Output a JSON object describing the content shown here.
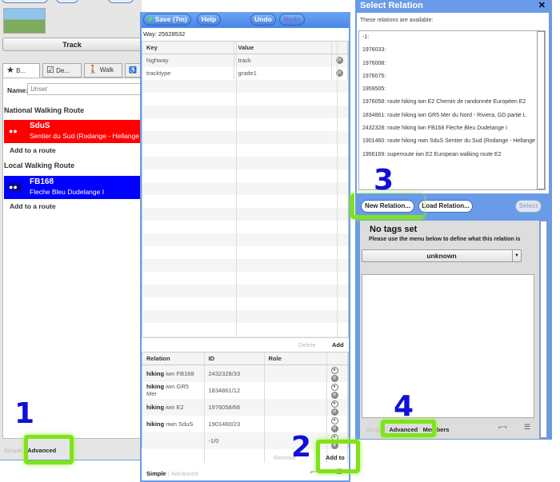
{
  "left_panel": {
    "preset": "Track",
    "tabs": [
      "B...",
      "De...",
      "Walk"
    ],
    "name_label": "Name:",
    "name_placeholder": "Unset",
    "sections": [
      {
        "heading": "National Walking Route",
        "ref": "SduS",
        "name": "Sentier du Sud (Rodange - Hellange",
        "color": "#ff0000",
        "action": "Add to a route"
      },
      {
        "heading": "Local Walking Route",
        "ref": "FB168",
        "name": "Fleche Bleu Dudelange I",
        "color": "#0000ff",
        "action": "Add to a route"
      }
    ],
    "footer": {
      "simple": "Simple",
      "advanced": "Advanced"
    }
  },
  "editor": {
    "toolbar": {
      "save": "Save (7m)",
      "help": "Help",
      "undo": "Undo",
      "redo": "Redo"
    },
    "way": "Way: 25628532",
    "tag_headers": [
      "Key",
      "Value"
    ],
    "tags": [
      [
        "highway",
        "track"
      ],
      [
        "tracktype",
        "grade1"
      ]
    ],
    "delete": "Delete",
    "add": "Add",
    "rel_headers": [
      "Relation",
      "ID",
      "Role"
    ],
    "relations": [
      [
        "hiking",
        "iwn FB168",
        "2432328/33"
      ],
      [
        "hiking",
        "iwn GR5 Mer",
        "1834861/12"
      ],
      [
        "hiking",
        "iwn E2",
        "1976058/66"
      ],
      [
        "hiking",
        "nwn SduS",
        "1901460/23"
      ],
      [
        "",
        "",
        "-1/0"
      ]
    ],
    "remove": "Remove",
    "add_to": "Add to",
    "footer": {
      "simple": "Simple",
      "advanced": "Advanced"
    }
  },
  "dialog": {
    "title": "Select Relation",
    "close": "✕",
    "intro": "These relations are available:",
    "items": [
      "-1:",
      "1976033:",
      "1976008:",
      "1976075:",
      "1959505:",
      "1976058: route hiking iwn E2 Chemin de randonnée Européen E2",
      "1834861: route hiking iwn GR5 Mer du Nord - Riviera, GD partie L",
      "2432328: route hiking lwn FB168 Fleche Bleu Dudelange I",
      "1901460: route hiking nwn SduS Sentier du Sud (Rodange - Hellange",
      "1956169: superroute iwn E2 European walking route E2"
    ],
    "new_relation": "New Relation...",
    "load_relation": "Load Relation...",
    "select": "Select",
    "no_tags": "No tags set",
    "hint": "Please use the menu below to define what this relation is",
    "type": "unknown",
    "footer": {
      "simple": "Simple",
      "advanced": "Advanced",
      "members": "Members"
    }
  },
  "annotations": [
    "1",
    "2",
    "3",
    "4"
  ],
  "highlight_color": "#7fe31a"
}
